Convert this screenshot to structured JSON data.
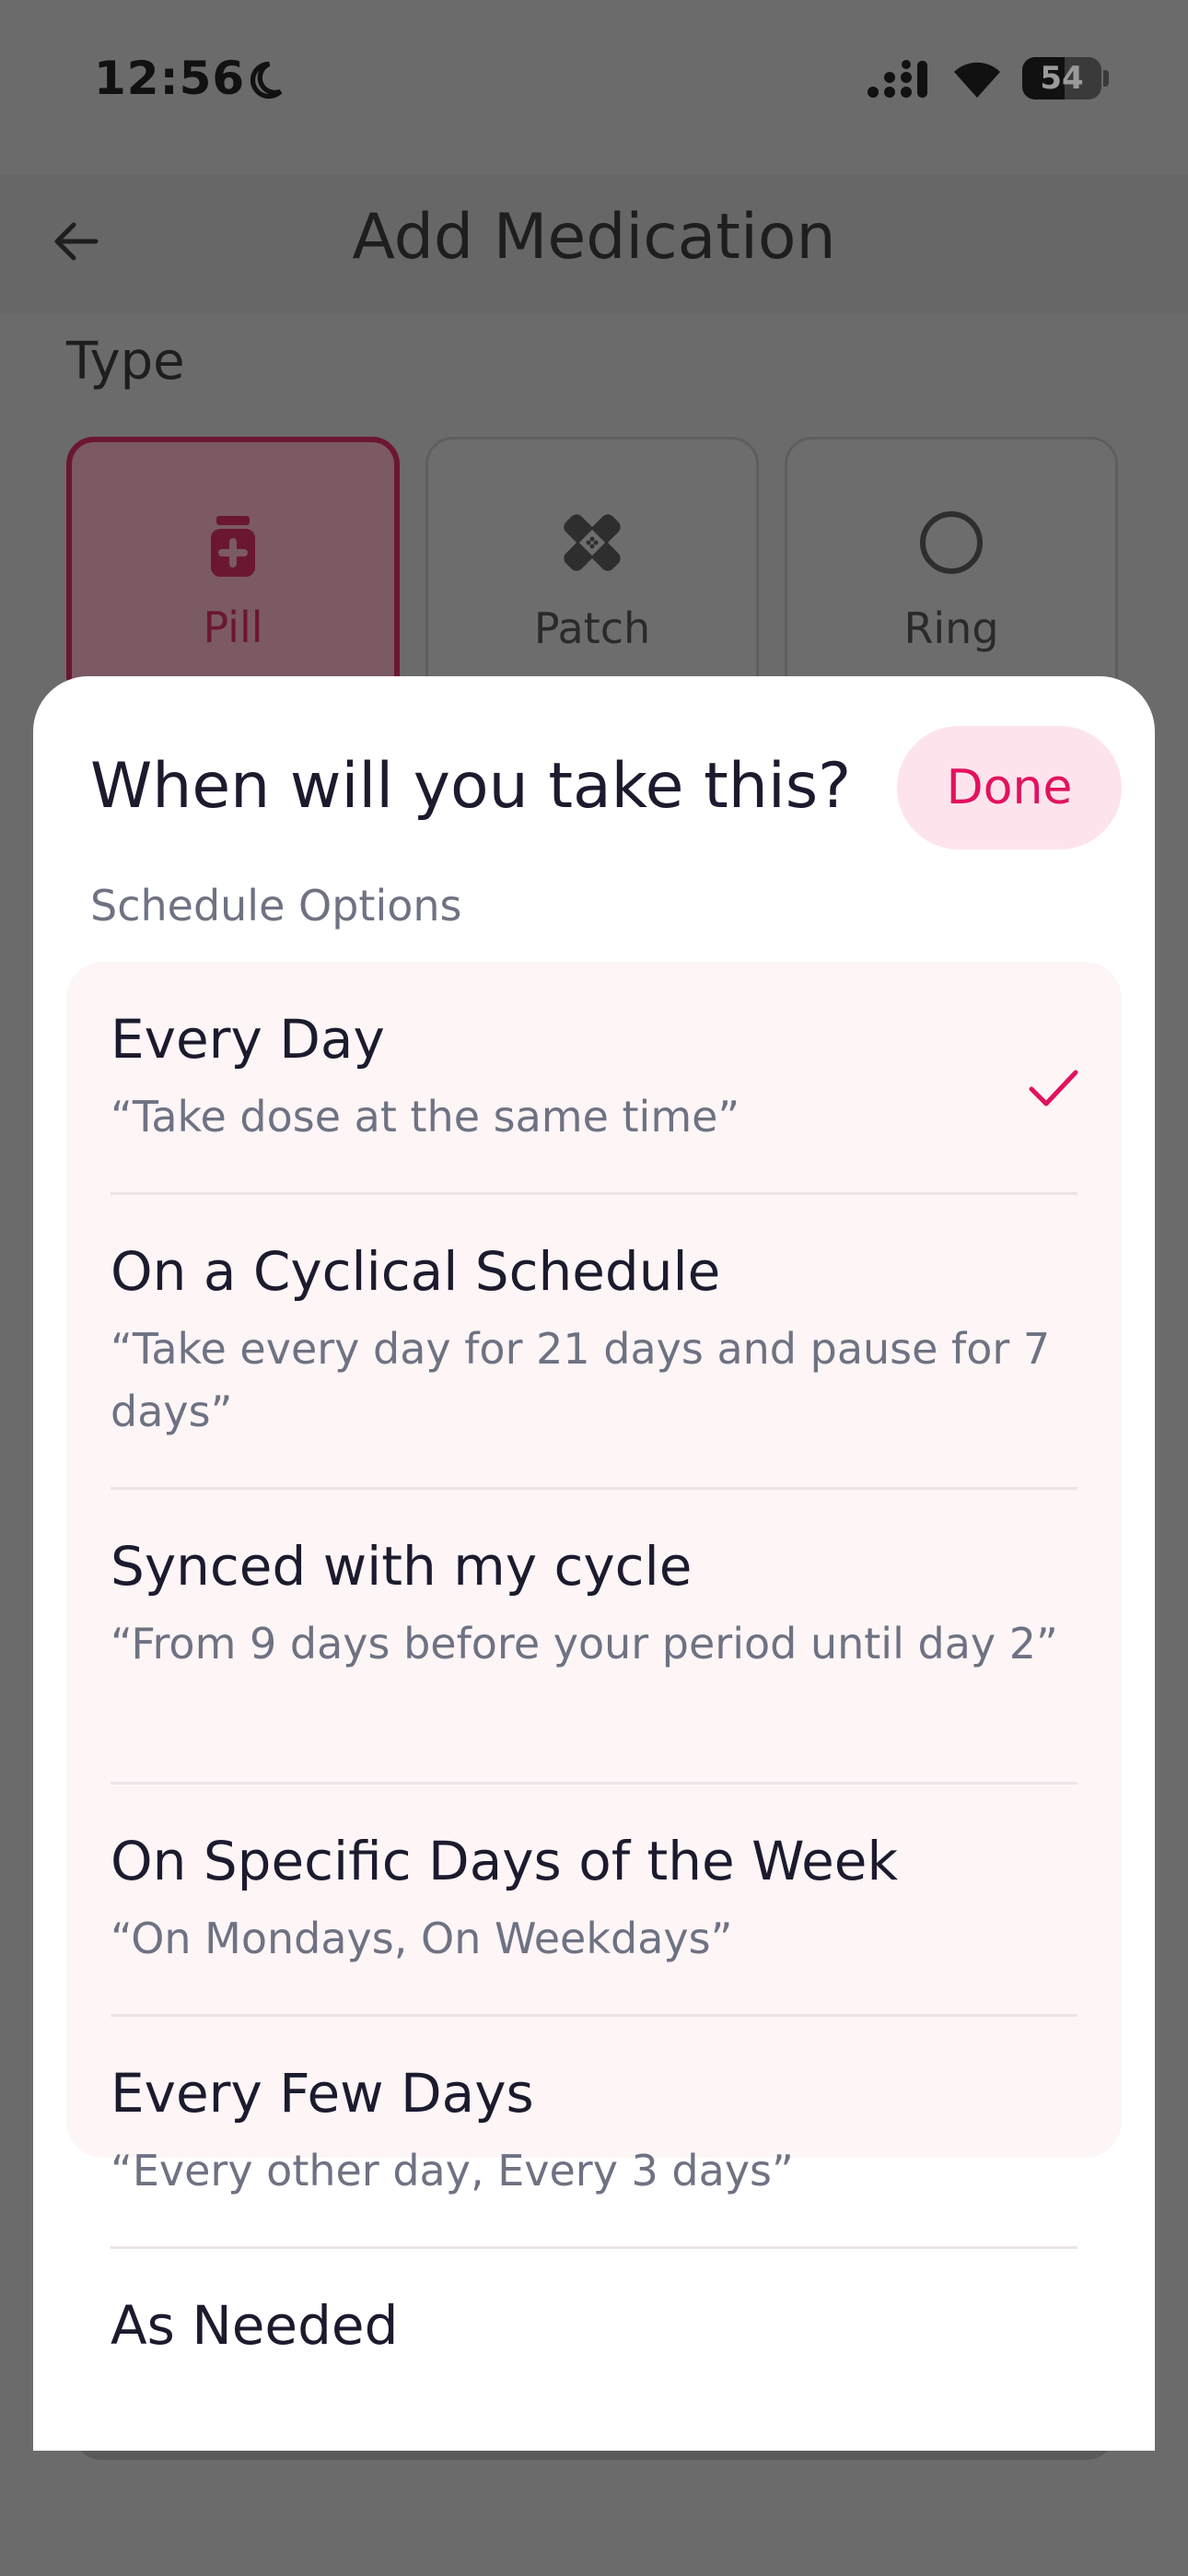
{
  "status_bar": {
    "time": "12:56",
    "battery_percent": "54",
    "battery_level": 0.54
  },
  "header": {
    "title": "Add Medication"
  },
  "type_section": {
    "label": "Type",
    "options": [
      {
        "label": "Pill",
        "icon": "pill-bottle-icon",
        "selected": true
      },
      {
        "label": "Patch",
        "icon": "patch-icon",
        "selected": false
      },
      {
        "label": "Ring",
        "icon": "ring-icon",
        "selected": false
      }
    ]
  },
  "sheet": {
    "title": "When will you take this?",
    "done_label": "Done",
    "section_label": "Schedule Options",
    "options": [
      {
        "title": "Every Day",
        "description": "“Take dose at the same time”",
        "selected": true
      },
      {
        "title": "On a Cyclical Schedule",
        "description": "“Take every day for 21 days and pause for 7 days”",
        "selected": false
      },
      {
        "title": "Synced with my cycle",
        "description": "“From 9 days before your period until day 2”",
        "selected": false
      },
      {
        "title": "On Specific Days of the Week",
        "description": "“On Mondays, On Weekdays”",
        "selected": false
      },
      {
        "title": "Every Few Days",
        "description": "“Every other day, Every 3 days”",
        "selected": false
      },
      {
        "title": "As Needed",
        "description": "",
        "selected": false
      }
    ]
  },
  "colors": {
    "accent": "#e2125e",
    "done_bg": "#fde4ec",
    "options_bg": "#fdf5f6",
    "overlay": "#6b6b6b"
  }
}
